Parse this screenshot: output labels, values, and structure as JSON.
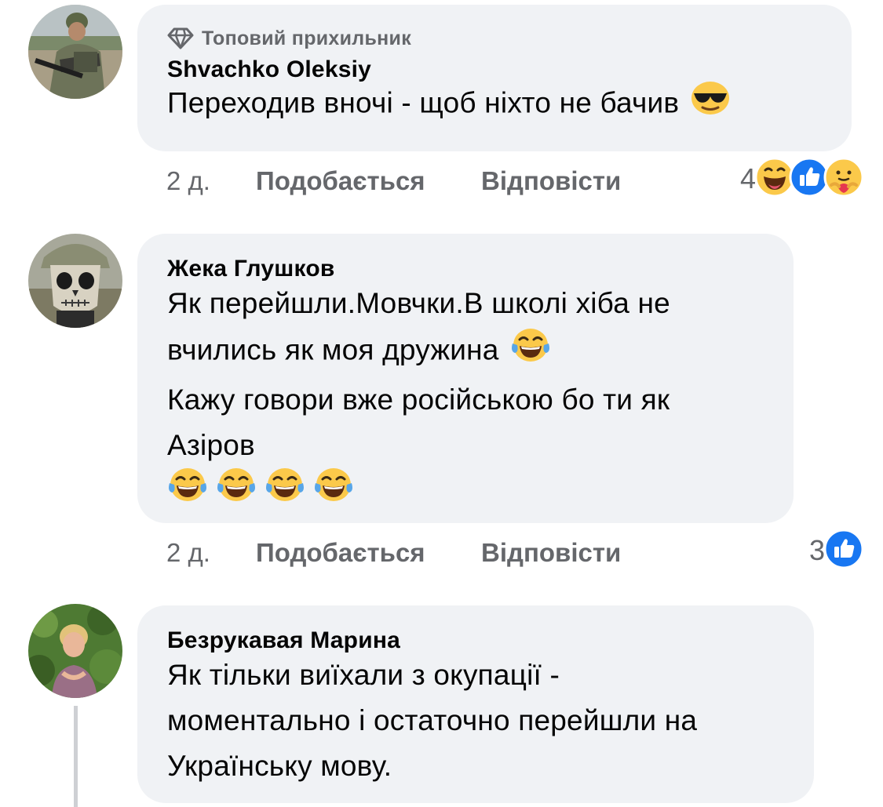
{
  "comments": [
    {
      "badge": "Топовий прихильник",
      "author": "Shvachko Oleksiy",
      "lines": [
        "Переходив вночі - щоб ніхто не бачив"
      ],
      "emoji": "smiling-face-with-sunglasses",
      "time": "2 д.",
      "like_label": "Подобається",
      "reply_label": "Відповісти",
      "reaction_count": "4",
      "reactions": [
        "haha-icon",
        "like-icon",
        "care-icon"
      ]
    },
    {
      "author": "Жека Глушков",
      "lines": [
        "Як перейшли.Мовчки.В школі хіба не",
        "вчились як моя дружина",
        "Кажу говори вже російською бо ти як",
        "Азіров"
      ],
      "emoji": "face-with-tears-of-joy",
      "time": "2 д.",
      "like_label": "Подобається",
      "reply_label": "Відповісти",
      "reaction_count": "3",
      "reactions": [
        "like-icon"
      ]
    },
    {
      "author": "Безрукавая Марина",
      "lines": [
        "Як тільки виїхали з окупації -",
        "моментально і остаточно перейшли на",
        "Українську мову."
      ]
    }
  ],
  "colors": {
    "bubble_bg": "#f0f2f5",
    "meta_text": "#65676b",
    "like_blue": "#1877f2",
    "thread_line": "#ced0d4"
  }
}
